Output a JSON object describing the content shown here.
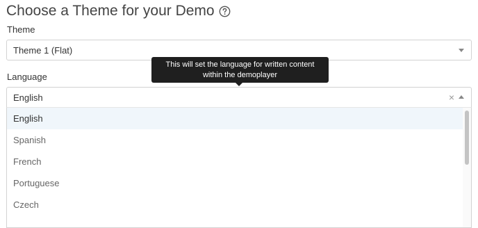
{
  "page": {
    "title": "Choose a Theme for your Demo",
    "help_icon": "question-circle-icon"
  },
  "theme": {
    "label": "Theme",
    "value": "Theme 1 (Flat)",
    "caret_icon": "caret-down-icon"
  },
  "language": {
    "label": "Language",
    "value": "English",
    "clear_symbol": "×",
    "caret_icon": "caret-up-icon",
    "options": [
      "English",
      "Spanish",
      "French",
      "Portuguese",
      "Czech"
    ],
    "highlighted": "English"
  },
  "tooltip": {
    "line1": "This will set the language for written content",
    "line2": "within the demoplayer"
  },
  "colors": {
    "tooltip_bg": "#1f1f1f",
    "highlight_bg": "#f0f6fb",
    "border": "#d2d2d2"
  }
}
